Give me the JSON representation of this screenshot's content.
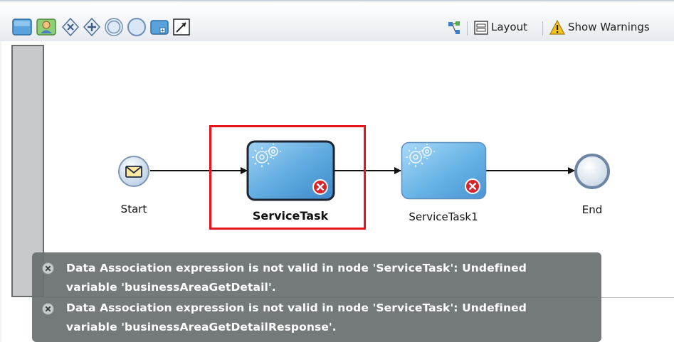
{
  "toolbar": {
    "palette_icons": [
      "swimlane-icon",
      "role-icon",
      "gateway-exclusive-icon",
      "gateway-parallel-icon",
      "intermediate-event-icon",
      "event-icon",
      "subprocess-icon",
      "connector-icon"
    ],
    "layout_label": "Layout",
    "warnings_label": "Show Warnings"
  },
  "diagram": {
    "nodes": [
      {
        "id": "start",
        "label": "Start",
        "type": "message-start-event"
      },
      {
        "id": "servicetask",
        "label": "ServiceTask",
        "type": "service-task",
        "error": true,
        "selected": true
      },
      {
        "id": "servicetask1",
        "label": "ServiceTask1",
        "type": "service-task",
        "error": true
      },
      {
        "id": "end",
        "label": "End",
        "type": "end-event"
      }
    ]
  },
  "errors": {
    "line1a": "Data Association expression is not valid in node 'ServiceTask': Undefined",
    "line1b": "variable 'businessAreaGetDetail'.",
    "line2a": "Data Association expression is not valid in node 'ServiceTask': Undefined",
    "line2b": "variable 'businessAreaGetDetailResponse'."
  },
  "colors": {
    "highlight": "#e8141b",
    "error_red": "#d9232b",
    "task_blue": "#6fb4e6",
    "panel_gray": "#697070"
  }
}
